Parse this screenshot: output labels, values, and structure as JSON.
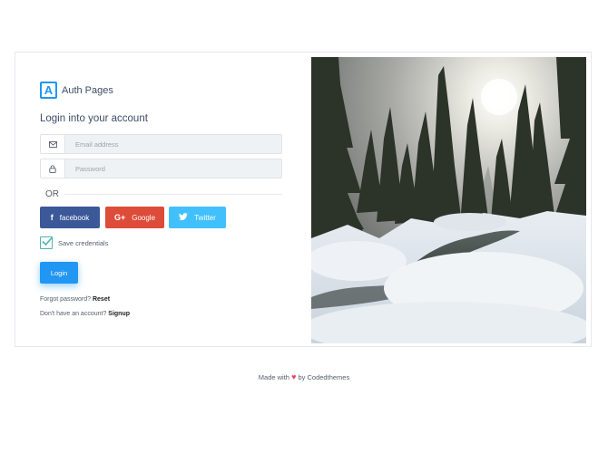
{
  "brand": {
    "name": "Auth Pages",
    "logo_letter": "A"
  },
  "form": {
    "title": "Login into your account",
    "email_placeholder": "Email address",
    "password_placeholder": "Password",
    "or": "OR",
    "social": {
      "facebook": "facebook",
      "google": "Google",
      "twitter": "Twitter"
    },
    "save_credentials": "Save credentials",
    "save_credentials_checked": true,
    "login": "Login",
    "forgot_text": "Forgot password?",
    "forgot_link": "Reset",
    "signup_text": "Don't have an account?",
    "signup_link": "Signup"
  },
  "footer": {
    "made_with": "Made with",
    "by": "by Codedthemes"
  },
  "colors": {
    "primary": "#2196f3",
    "facebook": "#3b5998",
    "google": "#dd4b39",
    "twitter": "#42c0fb",
    "heart": "#e8465f"
  },
  "icons": [
    "mail-icon",
    "lock-icon",
    "facebook-icon",
    "google-plus-icon",
    "twitter-icon",
    "checkbox-check-icon",
    "heart-icon"
  ]
}
